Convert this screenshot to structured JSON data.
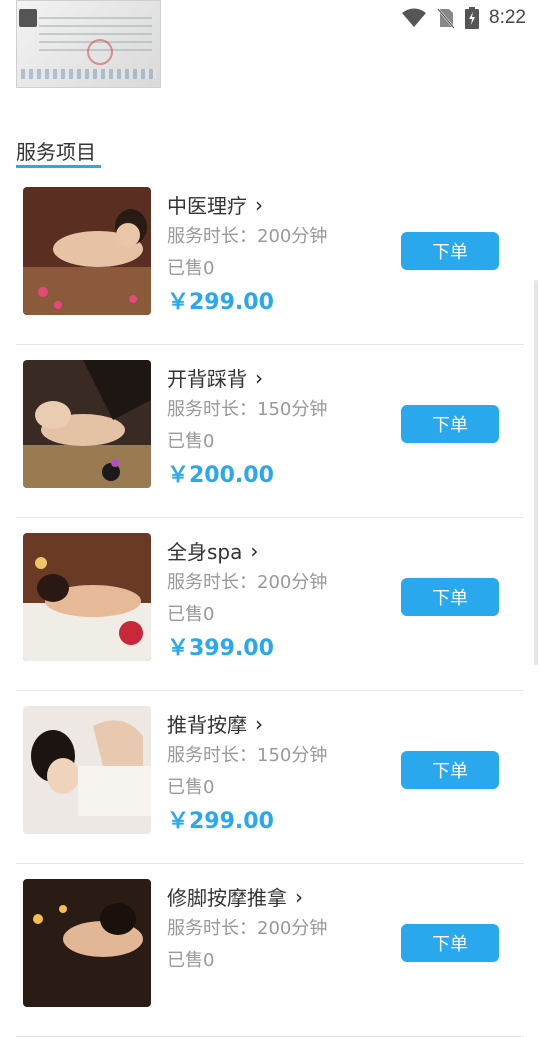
{
  "status_bar": {
    "time": "8:22",
    "icons": [
      "wifi-icon",
      "no-sim-icon",
      "battery-charging-icon"
    ]
  },
  "section": {
    "title": "服务项目"
  },
  "colors": {
    "accent": "#2aa8ee",
    "muted": "#999999",
    "text": "#333333"
  },
  "services": [
    {
      "name": "中医理疗",
      "duration": "服务时长：200分钟",
      "sold": "已售0",
      "price": "￥299.00",
      "order_label": "下单"
    },
    {
      "name": "开背踩背",
      "duration": "服务时长：150分钟",
      "sold": "已售0",
      "price": "￥200.00",
      "order_label": "下单"
    },
    {
      "name": "全身spa",
      "duration": "服务时长：200分钟",
      "sold": "已售0",
      "price": "￥399.00",
      "order_label": "下单"
    },
    {
      "name": "推背按摩",
      "duration": "服务时长：150分钟",
      "sold": "已售0",
      "price": "￥299.00",
      "order_label": "下单"
    },
    {
      "name": "修脚按摩推拿",
      "duration": "服务时长：200分钟",
      "sold": "已售0",
      "price": "",
      "order_label": "下单"
    }
  ]
}
